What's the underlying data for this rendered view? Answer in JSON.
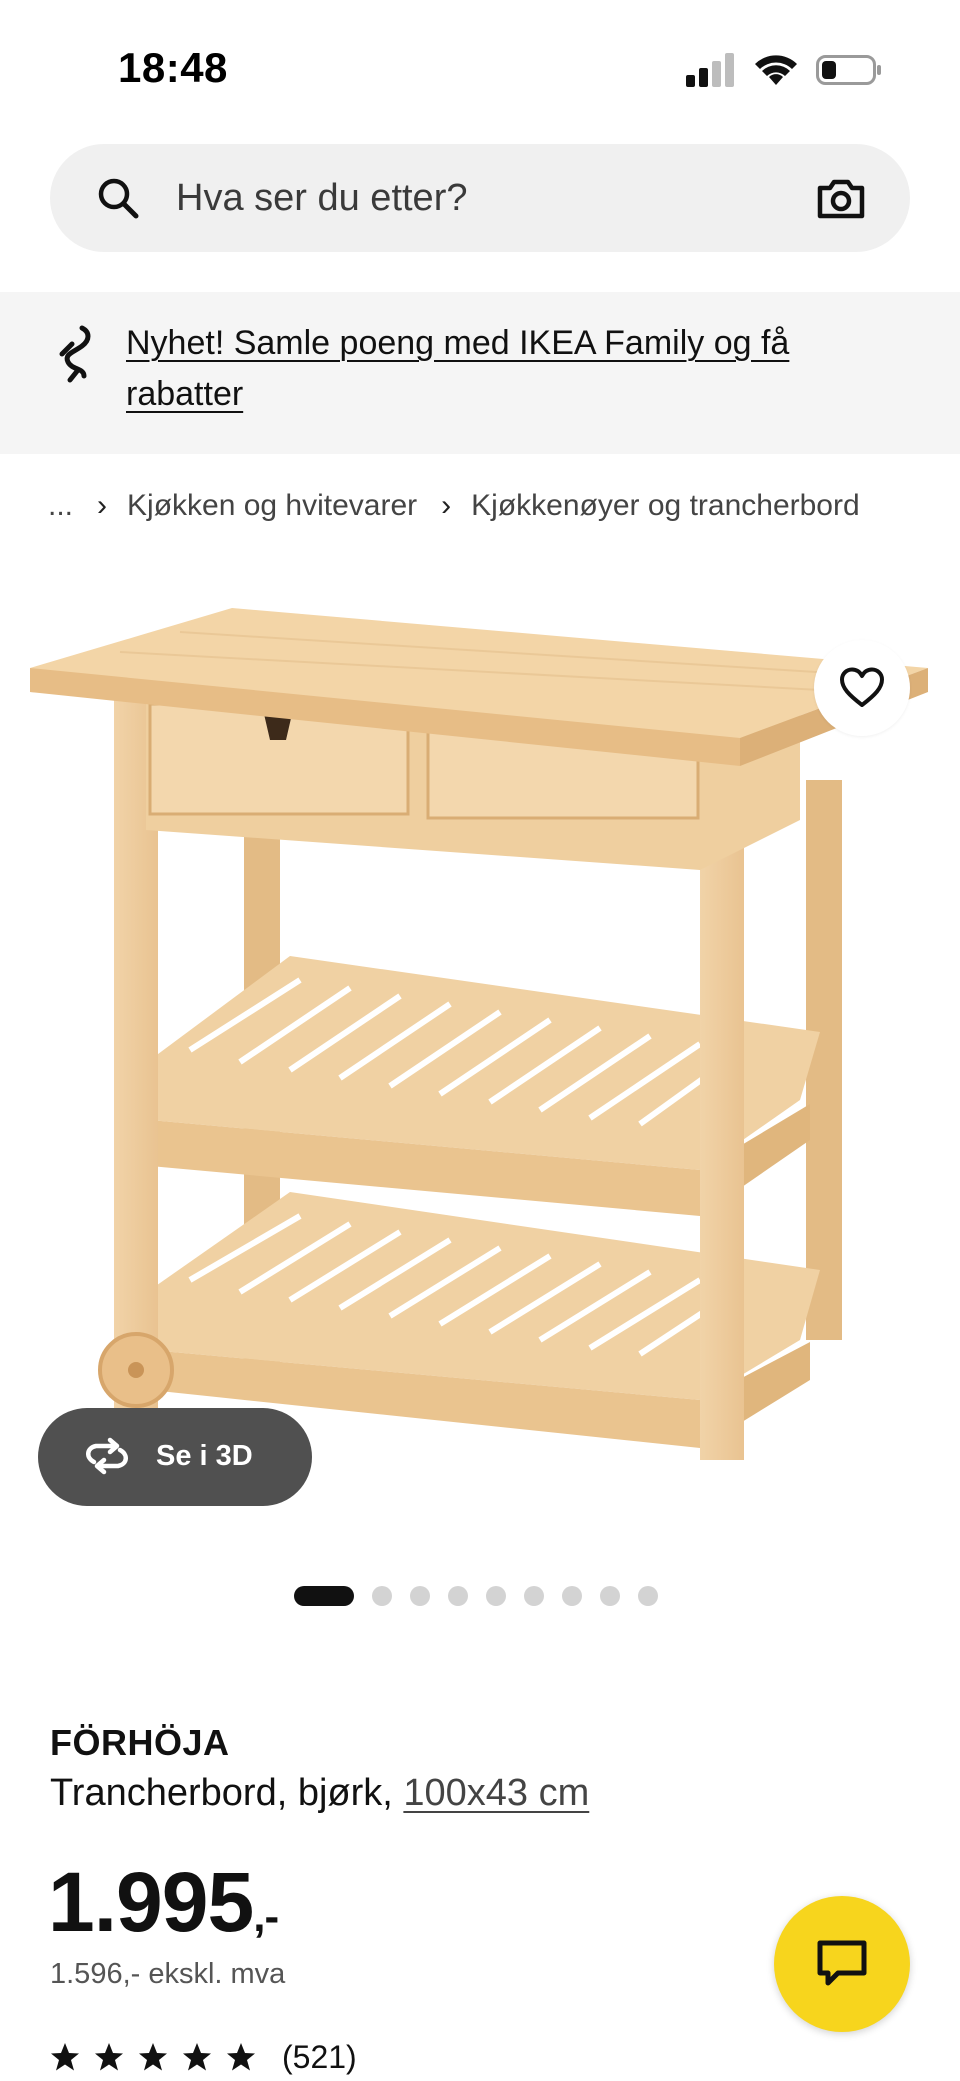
{
  "status_bar": {
    "time": "18:48"
  },
  "search": {
    "placeholder": "Hva ser du etter?"
  },
  "banner": {
    "text": "Nyhet! Samle poeng med IKEA Family og få rabatter"
  },
  "breadcrumb": {
    "items": [
      "...",
      "Kjøkken og hvitevarer",
      "Kjøkkenøyer og trancherbord"
    ],
    "separator": "›"
  },
  "gallery": {
    "see_3d_label": "Se i 3D",
    "image_count": 9,
    "active_index": 0
  },
  "product": {
    "name": "FÖRHÖJA",
    "description": "Trancherbord, bjørk, ",
    "size": "100x43 cm",
    "price_main": "1.995",
    "price_suffix": ",-",
    "price_ex_vat": "1.596,- ekskl. mva",
    "rating_count": "(521)",
    "rating_stars": 5
  },
  "colors": {
    "chat_button": "#f7d51d",
    "see_3d_button": "#505050",
    "search_bg": "#f0f0f0",
    "banner_bg": "#f5f5f5"
  },
  "icons": {
    "search": "search-icon",
    "camera": "camera-icon",
    "banner": "ikea-family-icon",
    "favorite": "heart-icon",
    "see_3d": "rotate-3d-icon",
    "chat": "chat-icon",
    "star": "star-icon"
  }
}
